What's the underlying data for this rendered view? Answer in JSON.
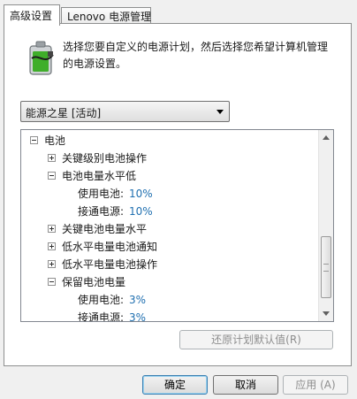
{
  "tabs": [
    {
      "label": "高级设置",
      "active": true
    },
    {
      "label": "Lenovo 电源管理",
      "active": false
    }
  ],
  "description": {
    "line1": "选择您要自定义的电源计划，然后选择您希望计算机管理",
    "line2": "的电源设置。"
  },
  "plan_select": {
    "selected": "能源之星 [活动]"
  },
  "tree": {
    "root": "电池",
    "critical_action": "关键级别电池操作",
    "low_level": "电池电量水平低",
    "on_battery_label": "使用电池:",
    "low_on_battery": "10%",
    "plugged_in_label": "接通电源:",
    "low_plugged_in": "10%",
    "critical_level": "关键电池电量水平",
    "low_notification": "低水平电量电池通知",
    "low_action": "低水平电量电池操作",
    "reserve_level": "保留电池电量",
    "reserve_on_battery": "3%",
    "reserve_plugged_in": "3%"
  },
  "buttons": {
    "restore_defaults": "还原计划默认值(R)",
    "ok": "确定",
    "cancel": "取消",
    "apply": "应用 (A)"
  },
  "colors": {
    "value_text": "#1f6fb0",
    "battery_green": "#3fae2a"
  }
}
